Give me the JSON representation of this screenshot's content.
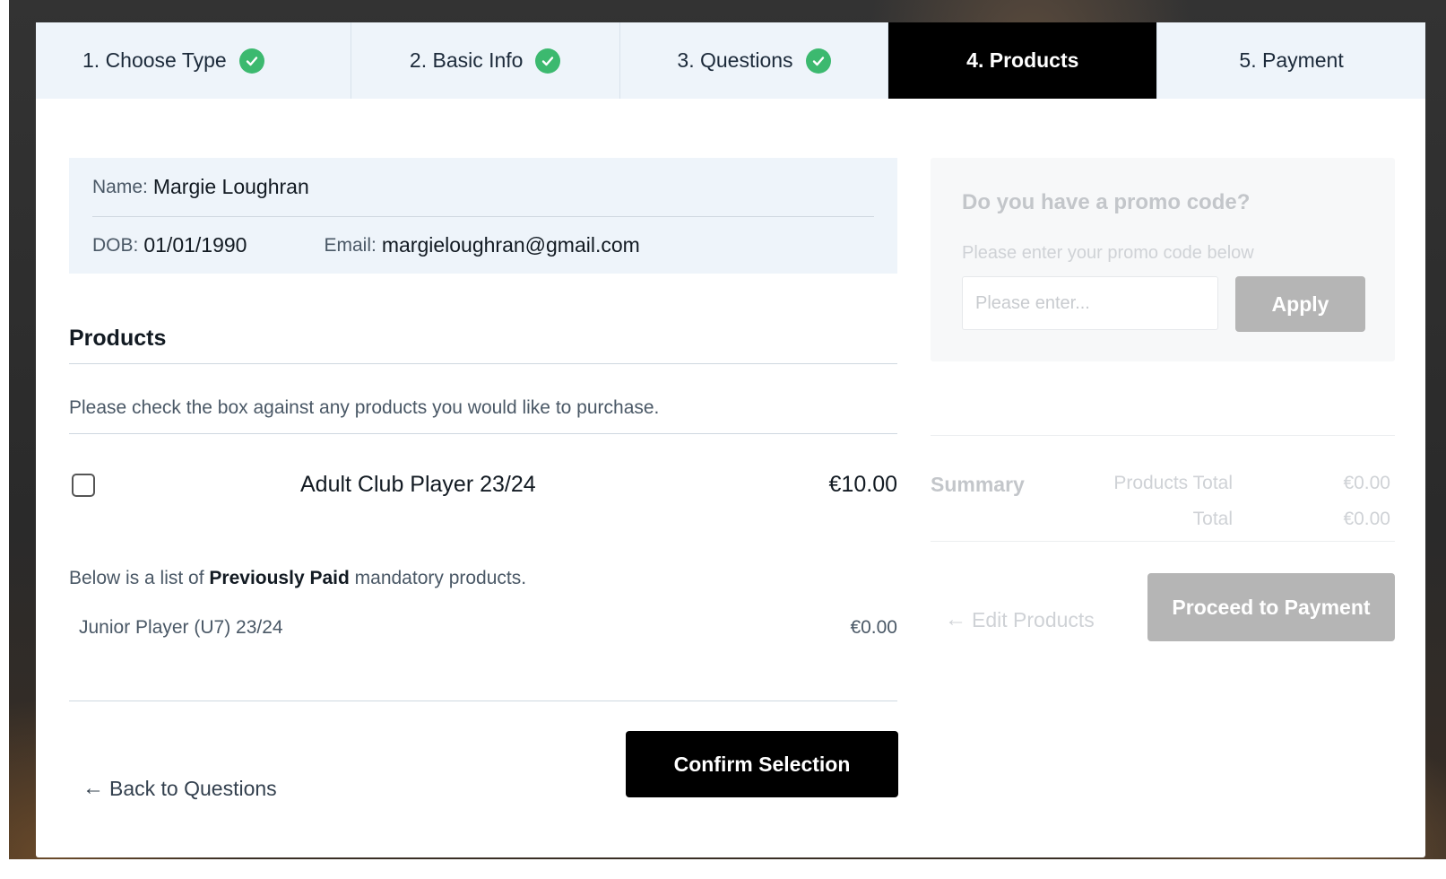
{
  "steps": [
    {
      "label": "1. Choose Type",
      "completed": true
    },
    {
      "label": "2. Basic Info",
      "completed": true
    },
    {
      "label": "3. Questions",
      "completed": true
    },
    {
      "label": "4. Products",
      "active": true
    },
    {
      "label": "5. Payment"
    }
  ],
  "participant": {
    "name_label": "Name:",
    "name": "Margie Loughran",
    "dob_label": "DOB:",
    "dob": "01/01/1990",
    "email_label": "Email:",
    "email": "margieloughran@gmail.com"
  },
  "products": {
    "title": "Products",
    "instruction": "Please check the box against any products you would like to purchase.",
    "items": [
      {
        "name": "Adult Club Player 23/24",
        "price": "€10.00",
        "checked": false
      }
    ],
    "previously_paid_note": {
      "prefix": "Below is a list of",
      "emphasis": "Previously Paid",
      "suffix": "mandatory products."
    },
    "previously_paid": [
      {
        "name": "Junior Player (U7) 23/24",
        "price": "€0.00"
      }
    ]
  },
  "actions": {
    "back_label": "Back to Questions",
    "confirm_label": "Confirm Selection"
  },
  "promo": {
    "title": "Do you have a promo code?",
    "subtitle": "Please enter your promo code below",
    "placeholder": "Please enter...",
    "apply_label": "Apply"
  },
  "summary": {
    "label": "Summary",
    "products_total_label": "Products Total",
    "products_total": "€0.00",
    "total_label": "Total",
    "total": "€0.00",
    "edit_label": "Edit Products",
    "proceed_label": "Proceed to Payment"
  },
  "colors": {
    "active_step": "#000000",
    "check_green": "#3cb96f",
    "info_bg": "#eef4fa",
    "disabled_button": "#b5b5b5"
  }
}
